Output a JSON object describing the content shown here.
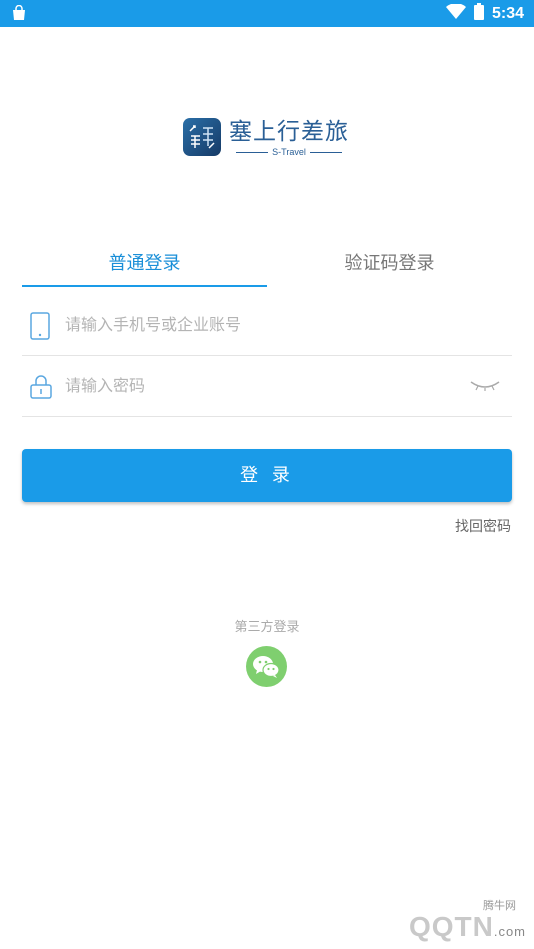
{
  "status_bar": {
    "time": "5:34",
    "icons": [
      "shopping-bag-icon",
      "wifi-icon",
      "battery-icon"
    ]
  },
  "logo": {
    "title": "塞上行差旅",
    "subtitle": "S-Travel"
  },
  "tabs": [
    {
      "label": "普通登录",
      "active": true
    },
    {
      "label": "验证码登录",
      "active": false
    }
  ],
  "form": {
    "account_placeholder": "请输入手机号或企业账号",
    "password_placeholder": "请输入密码"
  },
  "login_button": "登 录",
  "forgot_password": "找回密码",
  "third_party": {
    "label": "第三方登录",
    "icon": "wechat-icon"
  },
  "watermark": {
    "brand": "腾牛网",
    "url": "QQTN",
    "suffix": ".com"
  },
  "colors": {
    "primary": "#1a9be8",
    "logo_text": "#2a5f96",
    "wechat": "#7fcf6f"
  }
}
